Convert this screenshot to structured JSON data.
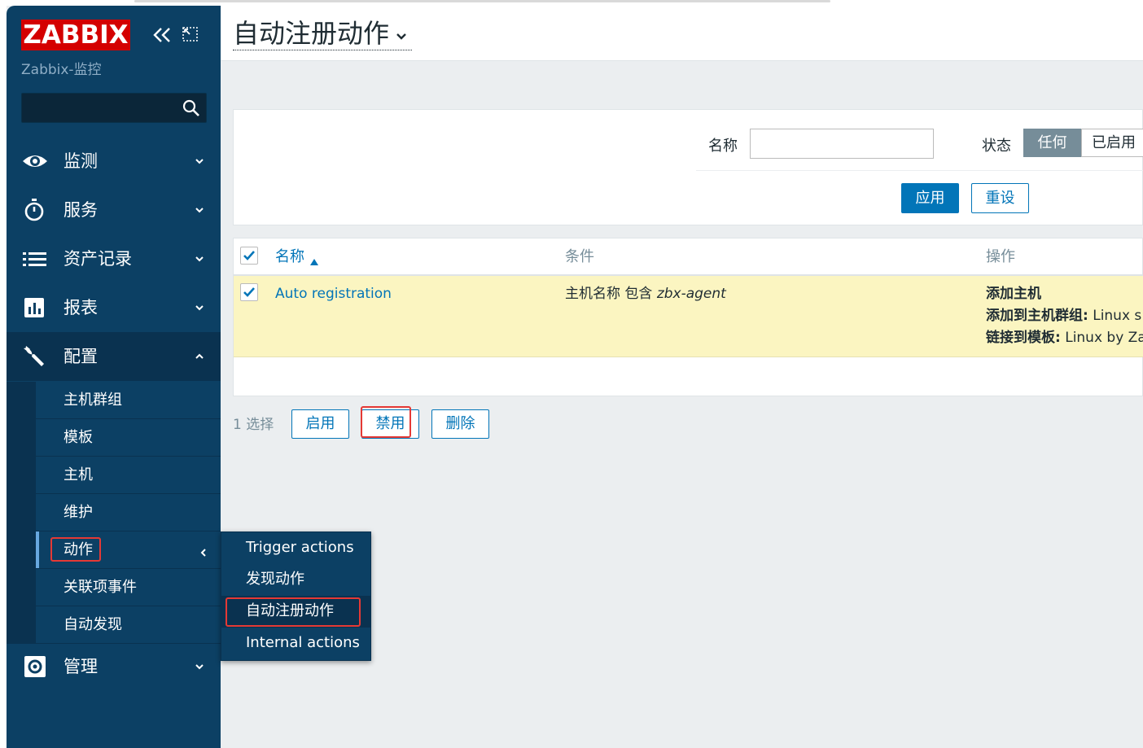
{
  "sidebar": {
    "logo": "ZABBIX",
    "server_name": "Zabbix-监控",
    "search": {
      "value": ""
    },
    "menu": [
      {
        "label": "监测",
        "icon": "eye-icon"
      },
      {
        "label": "服务",
        "icon": "stopwatch-icon"
      },
      {
        "label": "资产记录",
        "icon": "list-icon"
      },
      {
        "label": "报表",
        "icon": "bar-chart-icon"
      },
      {
        "label": "配置",
        "icon": "wrench-icon"
      },
      {
        "label": "管理",
        "icon": "gear-icon"
      }
    ],
    "config_submenu": [
      "主机群组",
      "模板",
      "主机",
      "维护",
      "动作",
      "关联项事件",
      "自动发现"
    ]
  },
  "actions_flyout": [
    "Trigger actions",
    "发现动作",
    "自动注册动作",
    "Internal actions"
  ],
  "header": {
    "title": "自动注册动作"
  },
  "filter": {
    "name_label": "名称",
    "name_value": "",
    "status_label": "状态",
    "status_options": [
      "任何",
      "已启用"
    ],
    "status_selected": "任何",
    "apply_label": "应用",
    "reset_label": "重设"
  },
  "table": {
    "columns": [
      "名称",
      "条件",
      "操作"
    ],
    "sort_column": "名称",
    "rows": [
      {
        "name": "Auto registration",
        "condition_prefix": "主机名称 包含 ",
        "condition_value": "zbx-agent",
        "ops": [
          {
            "label": "添加主机",
            "value": ""
          },
          {
            "label": "添加到主机群组:",
            "value": " Linux s"
          },
          {
            "label": "链接到模板:",
            "value": " Linux by Za"
          }
        ]
      }
    ]
  },
  "action_bar": {
    "selected_text": "1 选择",
    "enable_label": "启用",
    "disable_label": "禁用",
    "delete_label": "删除"
  },
  "colors": {
    "sidebar": "#0c4064",
    "logo_red": "#d40000",
    "link_blue": "#0275b8",
    "row_highlight": "#fbf5c1",
    "annotation_red": "#e53935"
  }
}
